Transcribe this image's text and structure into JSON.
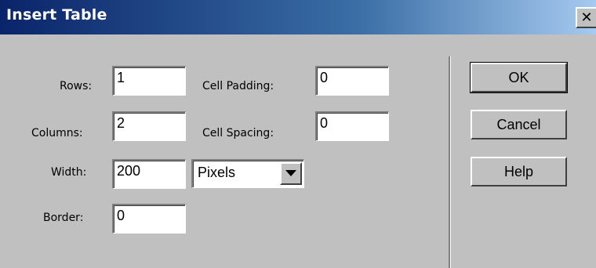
{
  "window": {
    "title": "Insert Table",
    "close_label": "✕"
  },
  "fields": {
    "rows": {
      "label": "Rows:",
      "value": "1"
    },
    "columns": {
      "label": "Columns:",
      "value": "2"
    },
    "width": {
      "label": "Width:",
      "value": "200"
    },
    "border": {
      "label": "Border:",
      "value": "0"
    },
    "cell_padding": {
      "label": "Cell Padding:",
      "value": "0"
    },
    "cell_spacing": {
      "label": "Cell Spacing:",
      "value": "0"
    }
  },
  "width_unit": {
    "selected": "Pixels"
  },
  "buttons": {
    "ok": "OK",
    "cancel": "Cancel",
    "help": "Help"
  },
  "icons": {
    "close": "close-icon",
    "dropdown": "chevron-down-icon"
  }
}
